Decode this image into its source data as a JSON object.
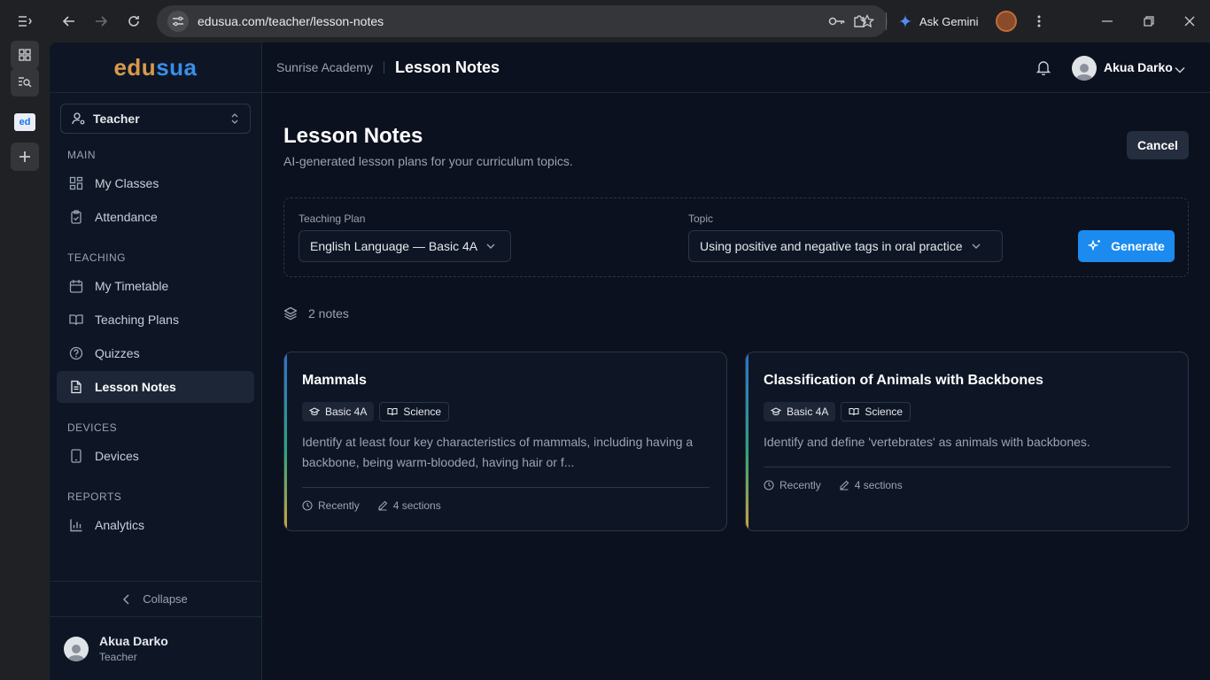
{
  "browser": {
    "url": "edusua.com/teacher/lesson-notes",
    "gemini_label": "Ask Gemini",
    "tab_favicon_text": "ed"
  },
  "brand": {
    "part1": "edu",
    "part2": "sua"
  },
  "sidebar": {
    "role": "Teacher",
    "sections": [
      {
        "title": "MAIN",
        "items": [
          {
            "label": "My Classes",
            "icon": "grid-icon"
          },
          {
            "label": "Attendance",
            "icon": "clipboard-icon"
          }
        ]
      },
      {
        "title": "TEACHING",
        "items": [
          {
            "label": "My Timetable",
            "icon": "calendar-icon"
          },
          {
            "label": "Teaching Plans",
            "icon": "book-open-icon"
          },
          {
            "label": "Quizzes",
            "icon": "help-circle-icon"
          },
          {
            "label": "Lesson Notes",
            "icon": "file-text-icon",
            "active": true
          }
        ]
      },
      {
        "title": "DEVICES",
        "items": [
          {
            "label": "Devices",
            "icon": "tablet-icon"
          }
        ]
      },
      {
        "title": "REPORTS",
        "items": [
          {
            "label": "Analytics",
            "icon": "bar-chart-icon"
          }
        ]
      }
    ],
    "collapse_label": "Collapse",
    "user": {
      "name": "Akua Darko",
      "role": "Teacher"
    }
  },
  "header": {
    "school": "Sunrise Academy",
    "page": "Lesson Notes",
    "user_name": "Akua Darko"
  },
  "main": {
    "title": "Lesson Notes",
    "subtitle": "AI-generated lesson plans for your curriculum topics.",
    "cancel_label": "Cancel",
    "form": {
      "plan_label": "Teaching Plan",
      "plan_value": "English Language — Basic 4A",
      "topic_label": "Topic",
      "topic_value": "Using positive and negative tags in oral practice",
      "generate_label": "Generate"
    },
    "count_label": "2 notes",
    "notes": [
      {
        "title": "Mammals",
        "grade": "Basic 4A",
        "subject": "Science",
        "description": "Identify at least four key characteristics of mammals, including having a backbone, being warm-blooded, having hair or f...",
        "time": "Recently",
        "sections": "4 sections"
      },
      {
        "title": "Classification of Animals with Backbones",
        "grade": "Basic 4A",
        "subject": "Science",
        "description": "Identify and define 'vertebrates' as animals with backbones.",
        "time": "Recently",
        "sections": "4 sections"
      }
    ]
  },
  "colors": {
    "accent": "#1b8bf0",
    "background": "#0b111e",
    "sidebar": "#0e1626",
    "brand_orange": "#d89a4a",
    "brand_blue": "#3a8ee8"
  }
}
